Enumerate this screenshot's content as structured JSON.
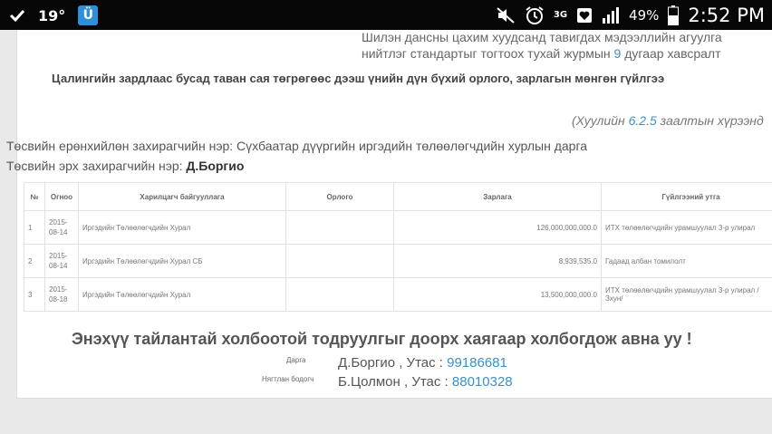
{
  "status_bar": {
    "temperature": "19°",
    "network": "3G",
    "battery": "49%",
    "time": "2:52 PM"
  },
  "header": {
    "line1": "Шилэн дансны цахим хуудсанд тавигдах мэдээллийн агуулга",
    "line2_pre": "нийтлэг стандартыг тогтоох тухай журмын ",
    "line2_num": "9",
    "line2_post": " дугаар хавсралт",
    "title": "Цалингийн зардлаас бусад таван сая төгрөгөөс дээш үнийн дүн бүхий орлого, зарлагын мөнгөн гүйлгээ",
    "ref_pre": "(Хуулийн ",
    "ref_num": "6.2.5",
    "ref_post": " заалтын хүрээнд"
  },
  "info": {
    "manager_label": "Төсвийн ерөнхийлөн захирагчийн нэр: ",
    "manager_value": "Сүхбаатар дүүргийн иргэдийн төлөөлөгчдийн хурлын дарга",
    "director_label": "Төсвийн эрх захирагчийн нэр: ",
    "director_value": "Д.Боргио"
  },
  "table": {
    "headers": [
      "№",
      "Огноо",
      "Харилцагч байгууллага",
      "Орлого",
      "Зарлага",
      "Гүйлгээний утга"
    ],
    "rows": [
      {
        "no": "1",
        "date_a": "2015-",
        "date_b": "08-14",
        "org": "Иргэдийн Төлөөлөгчдийн Хурал",
        "income": "",
        "expense": "126,000,000,000.0",
        "desc": "ИТХ төлөөлөгчдийн урамшуулал 3-р улирал"
      },
      {
        "no": "2",
        "date_a": "2015-",
        "date_b": "08-14",
        "org": "Иргэдийн Төлөөлөгчдийн Хурал СБ",
        "income": "",
        "expense": "8,939,535.0",
        "desc": "Гадаад албан томилолт"
      },
      {
        "no": "3",
        "date_a": "2015-",
        "date_b": "08-18",
        "org": "Иргэдийн Төлөөлөгчдийн Хурал",
        "income": "",
        "expense": "13,500,000,000.0",
        "desc": "ИТХ төлөөлөгчдийн урамшуулал 3-р улирал /Зхун/"
      }
    ]
  },
  "notice": "Энэхүү тайлантай холбоотой тодруулгыг доорх хаягаар холбогдож авна уу !",
  "contacts": [
    {
      "role": "Дарга",
      "name": "Д.Боргио , Утас : ",
      "phone": "99186681"
    },
    {
      "role": "Нягтлан бодогч",
      "name": "Б.Цолмон , Утас : ",
      "phone": "88010328"
    }
  ]
}
